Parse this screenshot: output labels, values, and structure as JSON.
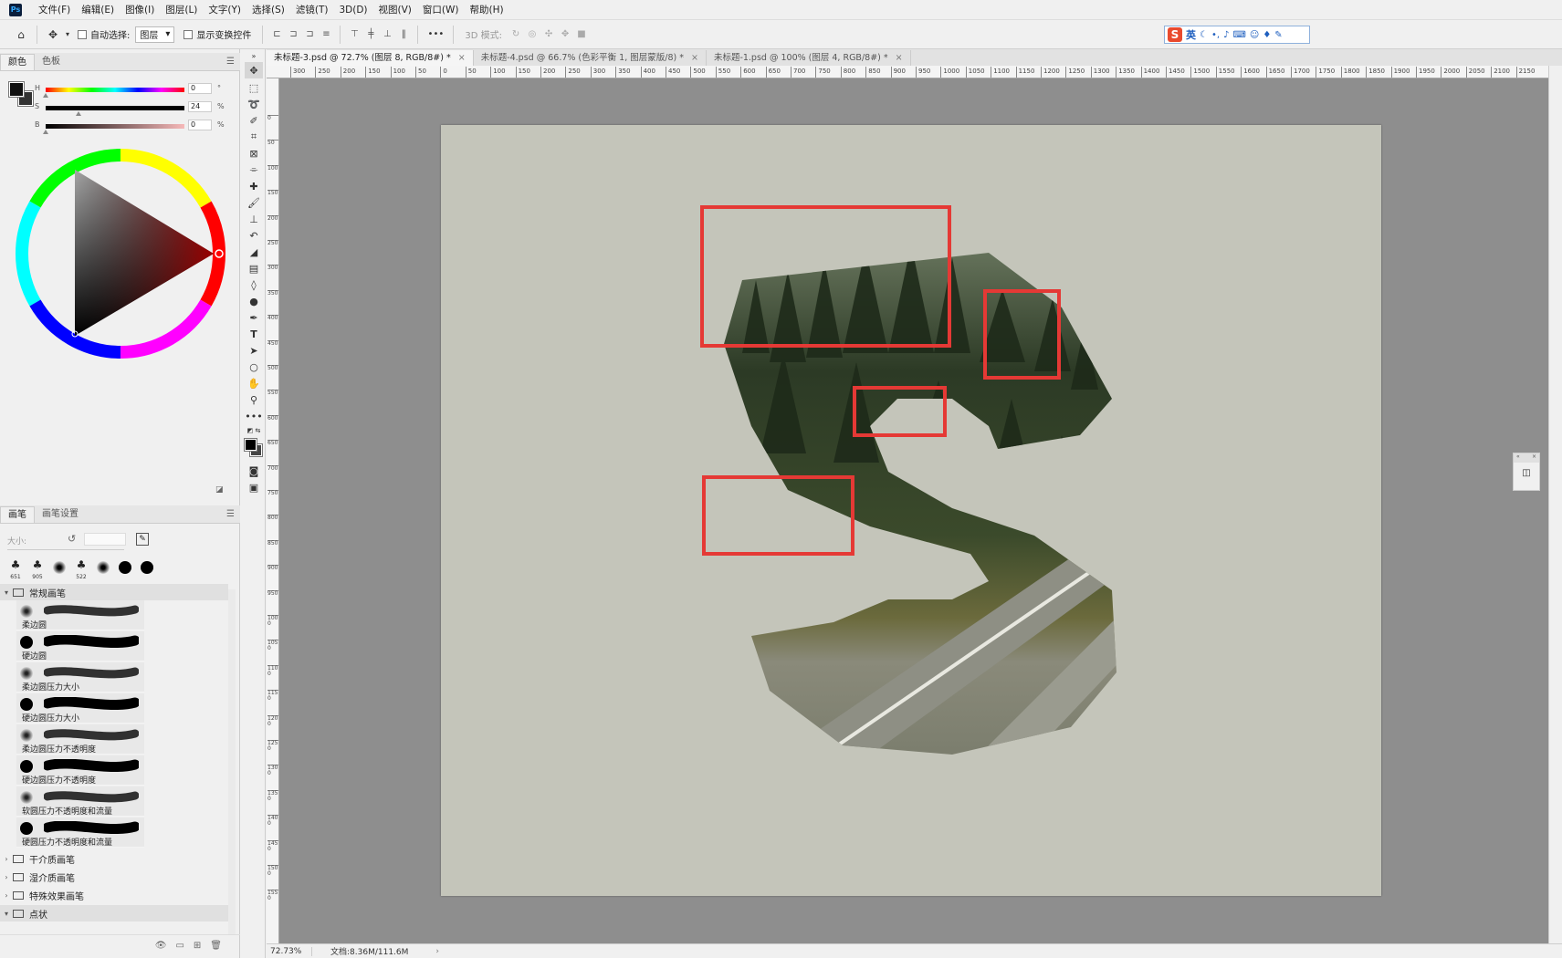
{
  "menu": [
    "文件(F)",
    "编辑(E)",
    "图像(I)",
    "图层(L)",
    "文字(Y)",
    "选择(S)",
    "滤镜(T)",
    "3D(D)",
    "视图(V)",
    "窗口(W)",
    "帮助(H)"
  ],
  "app": {
    "logo": "Ps"
  },
  "options": {
    "auto_select": "自动选择:",
    "layer_dropdown": "图层",
    "show_transform": "显示变换控件",
    "more": "•••",
    "mode3d": "3D 模式:"
  },
  "ime": {
    "lang": "英"
  },
  "color_panel": {
    "tabs": [
      "颜色",
      "色板"
    ],
    "sliders": [
      {
        "label": "H",
        "value": "0",
        "unit": "°",
        "knob": 0.0
      },
      {
        "label": "S",
        "value": "24",
        "unit": "%",
        "knob": 0.24
      },
      {
        "label": "B",
        "value": "0",
        "unit": "%",
        "knob": 0.0
      }
    ],
    "fg_color": "#111111",
    "bg_color": "#333333"
  },
  "brush_panel": {
    "tabs": [
      "画笔",
      "画笔设置"
    ],
    "size_label": "大小:",
    "recent": [
      {
        "num": "651",
        "kind": "tree"
      },
      {
        "num": "905",
        "kind": "tree"
      },
      {
        "num": "",
        "kind": "soft"
      },
      {
        "num": "522",
        "kind": "tree"
      },
      {
        "num": "",
        "kind": "soft"
      },
      {
        "num": "",
        "kind": "hard"
      },
      {
        "num": "",
        "kind": "hard"
      }
    ],
    "open_group": "常规画笔",
    "brushes": [
      {
        "name": "柔边圆",
        "soft": true
      },
      {
        "name": "硬边圆",
        "soft": false
      },
      {
        "name": "柔边圆压力大小",
        "soft": true
      },
      {
        "name": "硬边圆压力大小",
        "soft": false
      },
      {
        "name": "柔边圆压力不透明度",
        "soft": true
      },
      {
        "name": "硬边圆压力不透明度",
        "soft": false
      },
      {
        "name": "软圆压力不透明度和流量",
        "soft": true
      },
      {
        "name": "硬圆压力不透明度和流量",
        "soft": false
      }
    ],
    "groups": [
      "干介质画笔",
      "湿介质画笔",
      "特殊效果画笔",
      "点状"
    ]
  },
  "tabs": [
    {
      "label": "未标题-3.psd @ 72.7% (图层 8, RGB/8#) *",
      "active": true
    },
    {
      "label": "未标题-4.psd @ 66.7% (色彩平衡 1, 图层蒙版/8) *",
      "active": false
    },
    {
      "label": "未标题-1.psd @ 100% (图层 4, RGB/8#) *",
      "active": false
    }
  ],
  "ruler": {
    "h_labels": [
      "300",
      "250",
      "200",
      "150",
      "100",
      "50",
      "0",
      "50",
      "100",
      "150",
      "200",
      "250",
      "300",
      "350",
      "400",
      "450",
      "500",
      "550",
      "600",
      "650",
      "700",
      "750",
      "800",
      "850",
      "900",
      "950",
      "1000",
      "1050",
      "1100",
      "1150",
      "1200",
      "1250",
      "1300",
      "1350",
      "1400",
      "1450",
      "1500",
      "1550",
      "1600",
      "1650",
      "1700",
      "1750",
      "1800",
      "1850",
      "1900",
      "1950",
      "2000",
      "2050",
      "2100",
      "2150"
    ],
    "v_labels": [
      "0",
      "50",
      "100",
      "150",
      "200",
      "250",
      "300",
      "350",
      "400",
      "450",
      "500",
      "550",
      "600",
      "650",
      "700",
      "750",
      "800",
      "850",
      "900",
      "950",
      "1000",
      "1050",
      "1100",
      "1150",
      "1200",
      "1250",
      "1300",
      "1350",
      "1400",
      "1450",
      "1500",
      "1550"
    ]
  },
  "status": {
    "zoom": "72.73%",
    "doc": "文档:8.36M/111.6M",
    "arrow": "›"
  },
  "colors": {
    "canvas_bg": "#8e8e8e",
    "document": "#c4c5ba",
    "highlight": "#e53935",
    "accent": "#31a8ff"
  }
}
